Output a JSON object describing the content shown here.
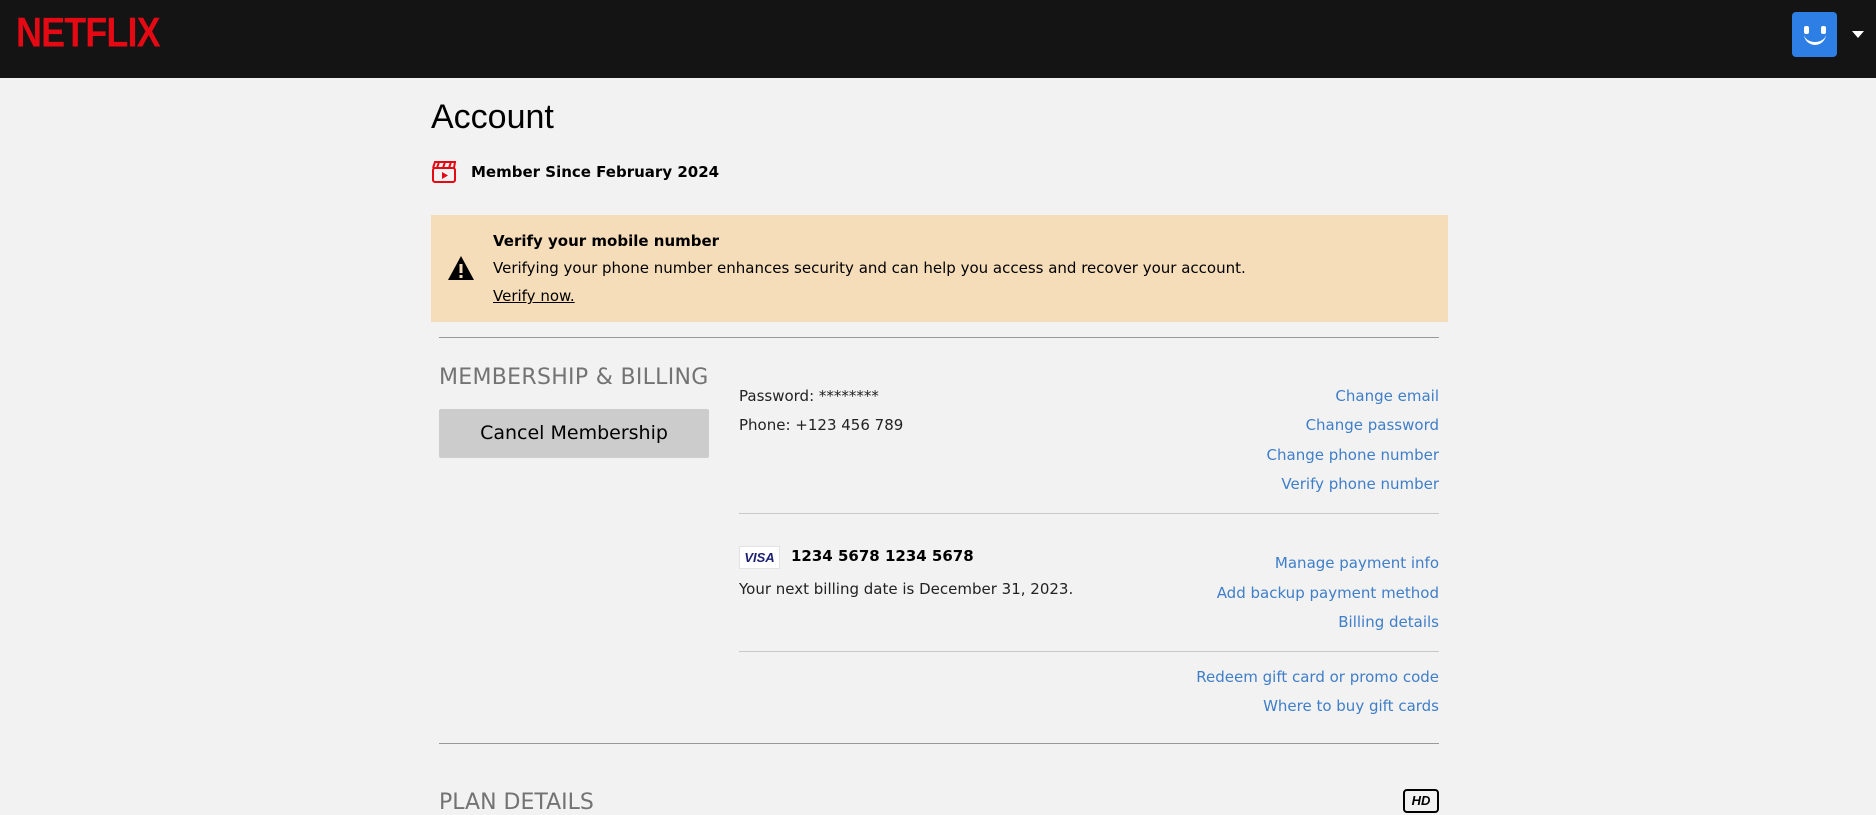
{
  "header": {
    "logo_text": "NETFLIX",
    "brand_color": "#e50914",
    "avatar_color": "#2d7fe6"
  },
  "page": {
    "title": "Account",
    "member_since": "Member Since February 2024"
  },
  "alert": {
    "title": "Verify your mobile number",
    "body": "Verifying your phone number enhances security and can help you access and recover your account.",
    "link": "Verify now.",
    "background": "#f6ddb9"
  },
  "membership": {
    "section_title": "MEMBERSHIP & BILLING",
    "cancel_button": "Cancel Membership",
    "password": "Password: ********",
    "phone": "Phone: +123 456 789",
    "account_links": [
      "Change email",
      "Change password",
      "Change phone number",
      "Verify phone number"
    ],
    "card_brand": "VISA",
    "card_number": "1234 5678 1234 5678",
    "next_billing": "Your next billing date is December 31, 2023.",
    "billing_links": [
      "Manage payment info",
      "Add backup payment method",
      "Billing details"
    ],
    "gift_links": [
      "Redeem gift card or promo code",
      "Where to buy gift cards"
    ],
    "link_color": "#3f7ec9"
  },
  "plan": {
    "section_title": "PLAN DETAILS",
    "quality_badge": "HD"
  }
}
